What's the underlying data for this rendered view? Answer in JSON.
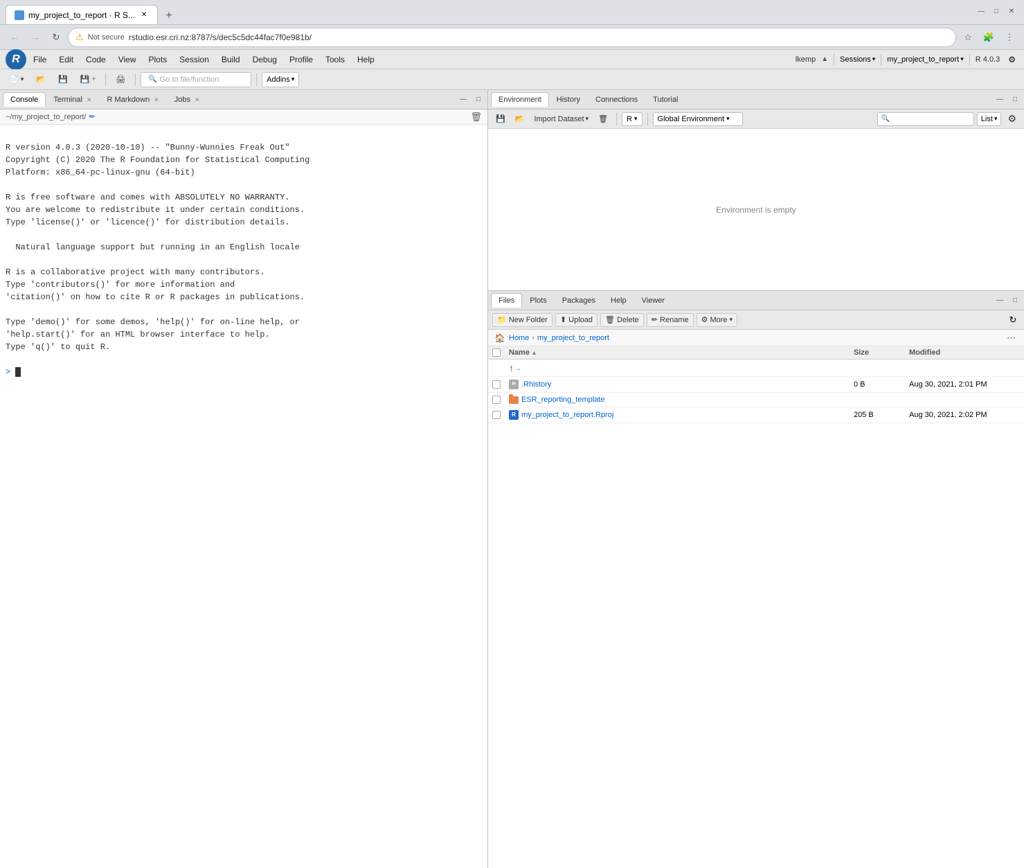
{
  "browser": {
    "tab_title": "my_project_to_report · R S...",
    "tab_favicon": "R",
    "url": "rstudio.esr.cri.nz:8787/s/dec5c5dc44fac7f0e981b/",
    "url_warning": "Not secure",
    "new_tab_label": "+"
  },
  "window_controls": {
    "minimize": "—",
    "maximize": "□",
    "close": "✕"
  },
  "rstudio": {
    "logo": "R",
    "menubar": {
      "items": [
        "File",
        "Edit",
        "Code",
        "View",
        "Plots",
        "Session",
        "Build",
        "Debug",
        "Profile",
        "Tools",
        "Help"
      ]
    },
    "toolbar": {
      "new_source_icon": "📄",
      "open_icon": "📂",
      "save_icon": "💾",
      "goto_file_placeholder": "Go to file/function",
      "addins_label": "Addins",
      "addins_arrow": "▾"
    },
    "top_right": {
      "user": "lkemp",
      "sessions_label": "Sessions",
      "sessions_arrow": "▾",
      "project_label": "my_project_to_report",
      "project_arrow": "▾",
      "version_label": "R 4.0.3"
    },
    "left_panel": {
      "tabs": [
        {
          "label": "Console",
          "active": true,
          "closeable": false
        },
        {
          "label": "Terminal",
          "active": false,
          "closeable": true
        },
        {
          "label": "R Markdown",
          "active": false,
          "closeable": true
        },
        {
          "label": "Jobs",
          "active": false,
          "closeable": true
        }
      ],
      "path": "~/my_project_to_report/",
      "console_output": [
        "",
        "R version 4.0.3 (2020-10-10) -- \"Bunny-Wunnies Freak Out\"",
        "Copyright (C) 2020 The R Foundation for Statistical Computing",
        "Platform: x86_64-pc-linux-gnu (64-bit)",
        "",
        "R is free software and comes with ABSOLUTELY NO WARRANTY.",
        "You are welcome to redistribute it under certain conditions.",
        "Type 'license()' or 'licence()' for distribution details.",
        "",
        "  Natural language support but running in an English locale",
        "",
        "R is a collaborative project with many contributors.",
        "Type 'contributors()' for more information and",
        "'citation()' on how to cite R or R packages in publications.",
        "",
        "Type 'demo()' for some demos, 'help()' for on-line help, or",
        "'help.start()' for an HTML browser interface to help.",
        "Type 'q()' to quit R.",
        "",
        ">"
      ]
    },
    "right_top_panel": {
      "tabs": [
        "Environment",
        "History",
        "Connections",
        "Tutorial"
      ],
      "active_tab": "Environment",
      "toolbar": {
        "import_dataset_label": "Import Dataset",
        "import_arrow": "▾",
        "r_label": "R",
        "r_arrow": "▾",
        "global_env_label": "Global Environment",
        "global_env_arrow": "▾",
        "list_label": "List",
        "list_arrow": "▾"
      },
      "empty_message": "Environment is empty"
    },
    "right_bottom_panel": {
      "tabs": [
        "Files",
        "Plots",
        "Packages",
        "Help",
        "Viewer"
      ],
      "active_tab": "Files",
      "toolbar": {
        "new_folder_label": "New Folder",
        "upload_label": "Upload",
        "delete_label": "Delete",
        "rename_label": "Rename",
        "more_label": "More",
        "more_arrow": "▾"
      },
      "path": {
        "home_icon": "🏠",
        "breadcrumbs": [
          "Home",
          "my_project_to_report"
        ]
      },
      "table": {
        "headers": [
          "",
          "Name",
          "Size",
          "Modified"
        ],
        "sort_col": "Name",
        "sort_dir": "▲",
        "rows": [
          {
            "type": "parent",
            "name": "..",
            "size": "",
            "modified": "",
            "icon": "↑"
          },
          {
            "type": "file",
            "name": ".Rhistory",
            "size": "0 B",
            "modified": "Aug 30, 2021, 2:01 PM",
            "icon_type": "rhistory"
          },
          {
            "type": "folder",
            "name": "ESR_reporting_template",
            "size": "",
            "modified": "",
            "icon_type": "folder_orange"
          },
          {
            "type": "file",
            "name": "my_project_to_report.Rproj",
            "size": "205 B",
            "modified": "Aug 30, 2021, 2:02 PM",
            "icon_type": "rproj"
          }
        ]
      }
    }
  }
}
